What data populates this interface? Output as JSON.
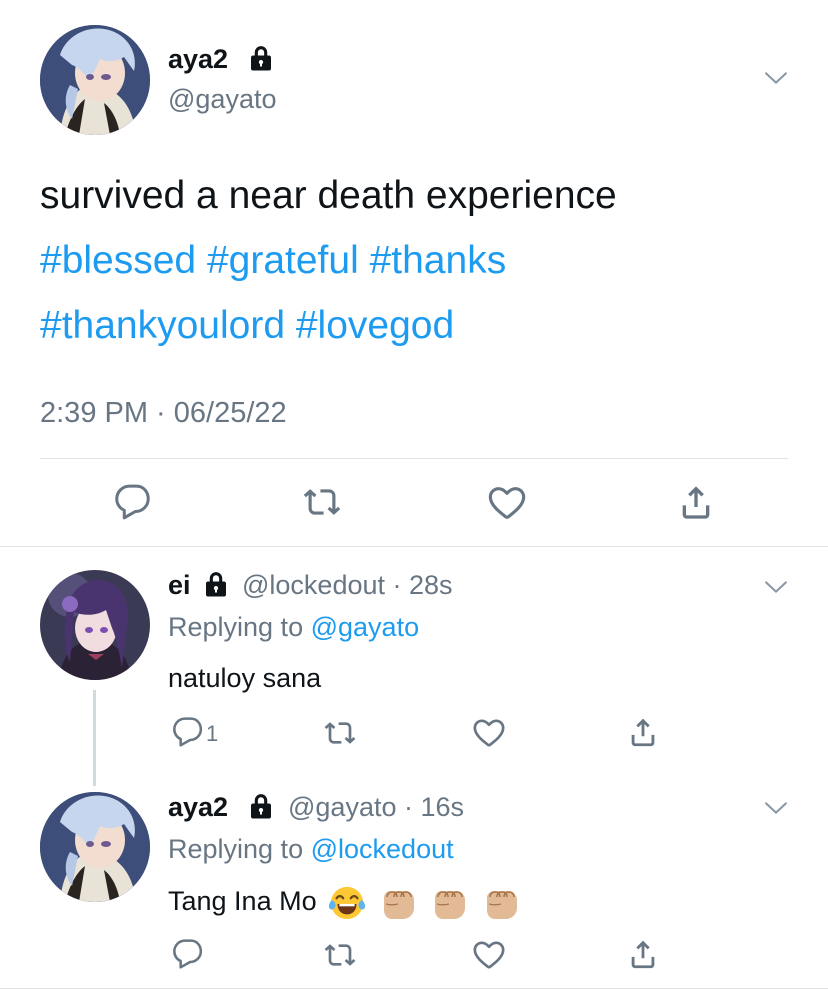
{
  "main_tweet": {
    "display_name": "aya2",
    "handle": "@gayato",
    "text_line1": "survived a near death experience",
    "hashtags_line2": [
      "#blessed",
      "#grateful",
      "#thanks"
    ],
    "hashtags_line3": [
      "#thankyoulord",
      "#lovegod"
    ],
    "timestamp": "2:39 PM · 06/25/22"
  },
  "replies": [
    {
      "display_name": "ei",
      "handle_time": "@lockedout · 28s",
      "replying_prefix": "Replying to",
      "replying_to": "@gayato",
      "text": "natuloy sana",
      "reply_count": "1"
    },
    {
      "display_name": "aya2",
      "handle_time": "@gayato · 16s",
      "replying_prefix": "Replying to",
      "replying_to": "@lockedout",
      "text": "Tang Ina Mo",
      "emojis": [
        "face-with-tears-of-joy",
        "oncoming-fist",
        "oncoming-fist",
        "oncoming-fist"
      ]
    }
  ],
  "colors": {
    "link": "#1d9bf0",
    "secondary_text": "#687684",
    "divider": "#dfe3e6"
  },
  "icons": [
    "lock-icon",
    "chevron-down-icon",
    "reply-icon",
    "retweet-icon",
    "like-icon",
    "share-icon"
  ]
}
